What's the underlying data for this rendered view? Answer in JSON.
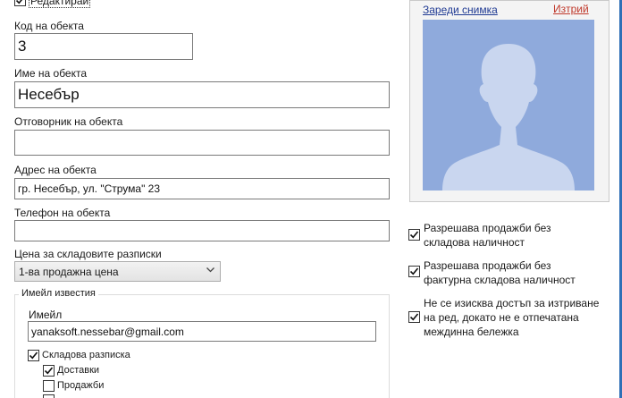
{
  "top": {
    "edit_label": "Редактирай",
    "edit_checked": true
  },
  "fields": {
    "code": {
      "label": "Код на обекта",
      "value": "3"
    },
    "name": {
      "label": "Име на обекта",
      "value": "Несебър"
    },
    "responsible": {
      "label": "Отговорник на обекта",
      "value": ""
    },
    "address": {
      "label": "Адрес на обекта",
      "value": "гр. Несебър, ул. \"Струма\" 23"
    },
    "phone": {
      "label": "Телефон на обекта",
      "value": ""
    },
    "price": {
      "label": "Цена за складовите разписки",
      "selected": "1-ва продажна цена"
    }
  },
  "email_group": {
    "legend": "Имейл известия",
    "email_label": "Имейл",
    "email_value": "yanaksoft.nessebar@gmail.com",
    "items": [
      {
        "label": "Складова разписка",
        "checked": true
      },
      {
        "label": "Доставки",
        "checked": true
      },
      {
        "label": "Продажби",
        "checked": false
      }
    ]
  },
  "photo": {
    "load_link": "Зареди снимка",
    "delete_link": "Изтрий",
    "delete_color": "#c0392b",
    "link_color": "#1f3a93",
    "placeholder_bg": "#8faadc",
    "silhouette_color": "#c9d6ef"
  },
  "options": [
    {
      "line1": "Разрешава продажби без",
      "line2": "складова наличност",
      "checked": true
    },
    {
      "line1": "Разрешава продажби без",
      "line2": "фактурна складова наличност",
      "checked": true
    },
    {
      "line1": "Не се изисква достъп за изтриване",
      "line2": "на ред, докато не е отпечатана",
      "line3": "междинна бележка",
      "checked": true
    }
  ]
}
